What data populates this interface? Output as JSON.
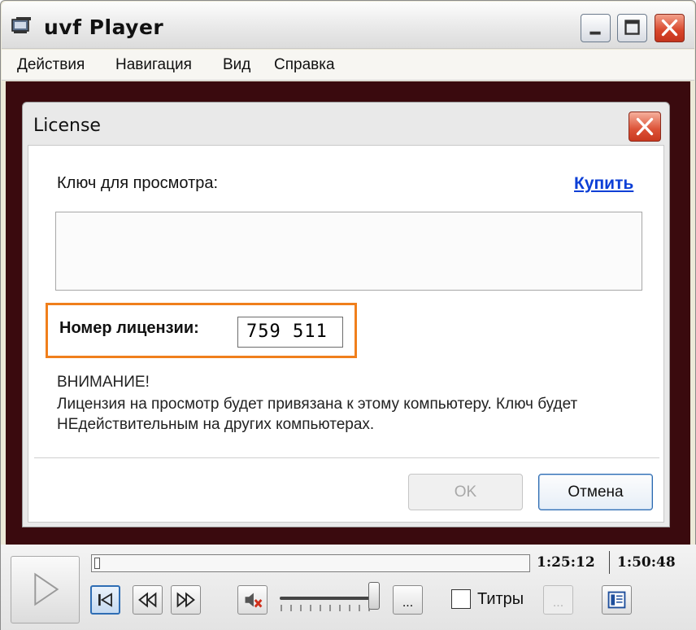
{
  "window": {
    "title": "uvf Player"
  },
  "menu": {
    "items": [
      "Действия",
      "Навигация",
      "Вид",
      "Справка"
    ]
  },
  "dialog": {
    "title": "License",
    "key_label": "Ключ для просмотра:",
    "buy_link": "Купить",
    "key_value": "",
    "license_label": "Номер лицензии:",
    "license_number": "759 511",
    "warning_title": "ВНИМАНИЕ!",
    "warning_text": "Лицензия на просмотр будет привязана к этому компьютеру. Ключ будет НЕдействительным на других компьютерах.",
    "ok_label": "OK",
    "cancel_label": "Отмена"
  },
  "player": {
    "current_time": "1:25:12",
    "total_time": "1:50:48",
    "subtitles_label": "Титры",
    "subtitles_checked": false,
    "more_label": "...",
    "progress_fraction": 0.0
  },
  "colors": {
    "highlight": "#f07f1c",
    "link": "#0c3fd6",
    "content_background": "#3a0a0e"
  },
  "icons": [
    "app-icon",
    "minimize-icon",
    "maximize-icon",
    "close-icon",
    "play-icon",
    "chapter-start-icon",
    "rewind-icon",
    "fast-forward-icon",
    "mute-icon",
    "playlist-icon"
  ]
}
